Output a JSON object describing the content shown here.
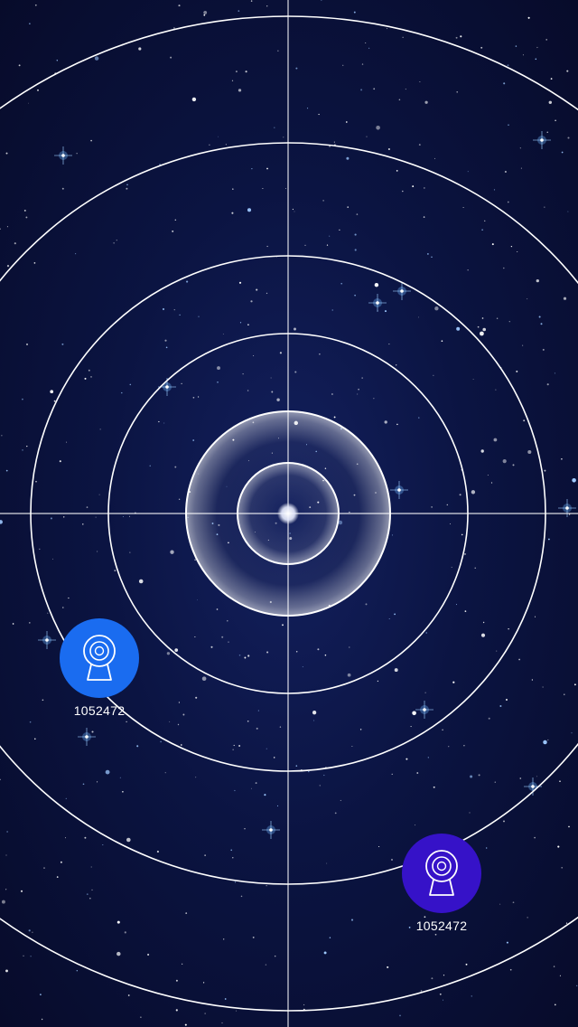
{
  "devices": [
    {
      "id_label": "1052472",
      "color": "#1a6cf0",
      "icon": "webcam-icon"
    },
    {
      "id_label": "1052472",
      "color": "#3612c8",
      "icon": "webcam-icon"
    }
  ],
  "theme": {
    "background": "#0b1442",
    "ring_color": "#ffffff",
    "center_glow": "#ffffff"
  }
}
